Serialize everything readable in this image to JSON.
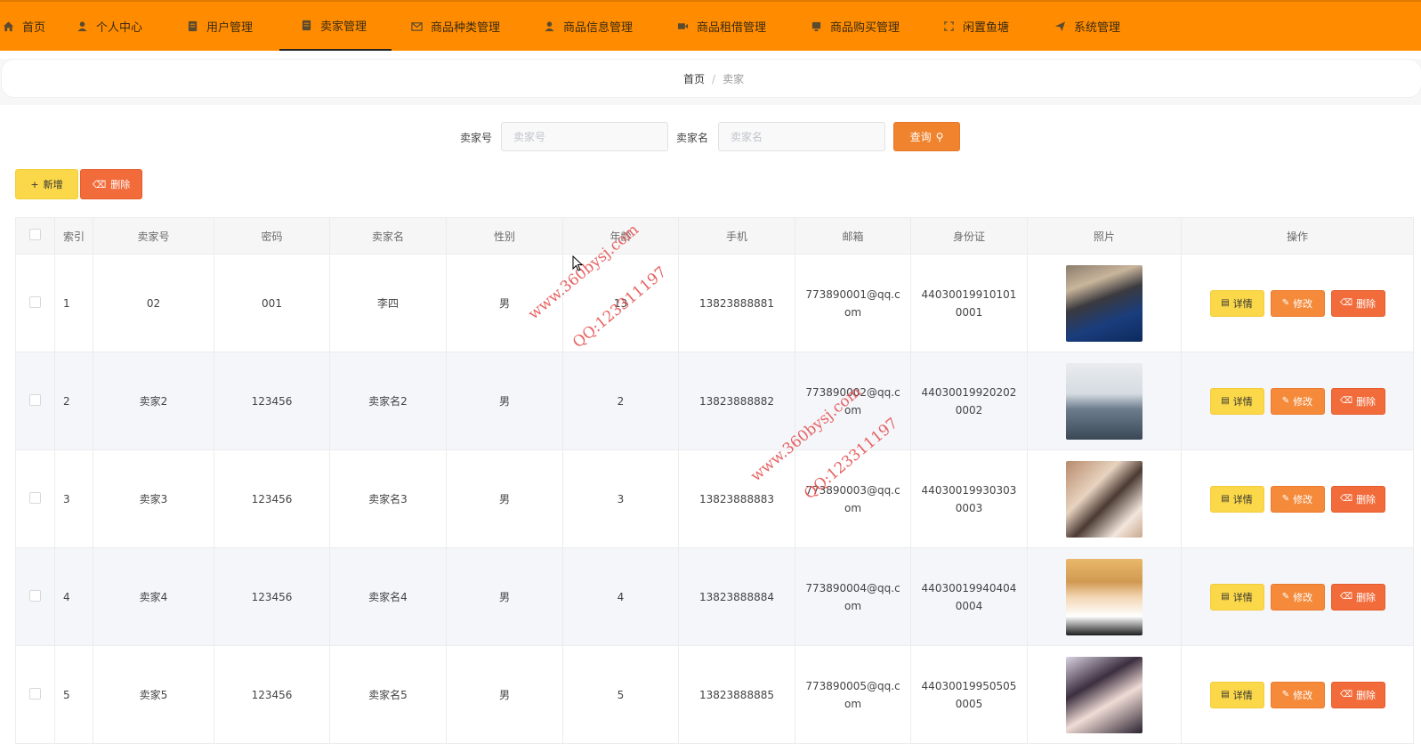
{
  "nav": {
    "items": [
      {
        "label": "首页",
        "icon": "home-icon"
      },
      {
        "label": "个人中心",
        "icon": "user-icon"
      },
      {
        "label": "用户管理",
        "icon": "document-icon"
      },
      {
        "label": "卖家管理",
        "icon": "document-icon",
        "active": true
      },
      {
        "label": "商品种类管理",
        "icon": "mail-icon"
      },
      {
        "label": "商品信息管理",
        "icon": "user-icon"
      },
      {
        "label": "商品租借管理",
        "icon": "video-icon"
      },
      {
        "label": "商品购买管理",
        "icon": "monitor-icon"
      },
      {
        "label": "闲置鱼塘",
        "icon": "frame-icon"
      },
      {
        "label": "系统管理",
        "icon": "send-icon"
      }
    ]
  },
  "breadcrumb": {
    "home": "首页",
    "sep": "/",
    "current": "卖家"
  },
  "search": {
    "field1_label": "卖家号",
    "field1_placeholder": "卖家号",
    "field2_label": "卖家名",
    "field2_placeholder": "卖家名",
    "query_label": "查询"
  },
  "actions": {
    "add_label": "新增",
    "delete_label": "删除"
  },
  "table": {
    "headers": [
      "索引",
      "卖家号",
      "密码",
      "卖家名",
      "性别",
      "年龄",
      "手机",
      "邮箱",
      "身份证",
      "照片",
      "操作"
    ],
    "rows": [
      {
        "index": "1",
        "seller_no": "02",
        "password": "001",
        "seller_name": "李四",
        "gender": "男",
        "age": "13",
        "phone": "13823888881",
        "email": "773890001@qq.com",
        "id_card": "440300199101010001"
      },
      {
        "index": "2",
        "seller_no": "卖家2",
        "password": "123456",
        "seller_name": "卖家名2",
        "gender": "男",
        "age": "2",
        "phone": "13823888882",
        "email": "773890002@qq.com",
        "id_card": "440300199202020002"
      },
      {
        "index": "3",
        "seller_no": "卖家3",
        "password": "123456",
        "seller_name": "卖家名3",
        "gender": "男",
        "age": "3",
        "phone": "13823888883",
        "email": "773890003@qq.com",
        "id_card": "440300199303030003"
      },
      {
        "index": "4",
        "seller_no": "卖家4",
        "password": "123456",
        "seller_name": "卖家名4",
        "gender": "男",
        "age": "4",
        "phone": "13823888884",
        "email": "773890004@qq.com",
        "id_card": "440300199404040004"
      },
      {
        "index": "5",
        "seller_no": "卖家5",
        "password": "123456",
        "seller_name": "卖家名5",
        "gender": "男",
        "age": "5",
        "phone": "13823888885",
        "email": "773890005@qq.com",
        "id_card": "440300199505050005"
      }
    ],
    "op_labels": {
      "detail": "详情",
      "edit": "修改",
      "delete": "删除"
    }
  },
  "watermark": {
    "site": "www.360bysj.com",
    "qq": "QQ:123311197"
  },
  "colors": {
    "nav_bg": "#ff8c00",
    "accent": "#f0832e",
    "danger": "#f26b3a",
    "warning": "#fbd849"
  }
}
